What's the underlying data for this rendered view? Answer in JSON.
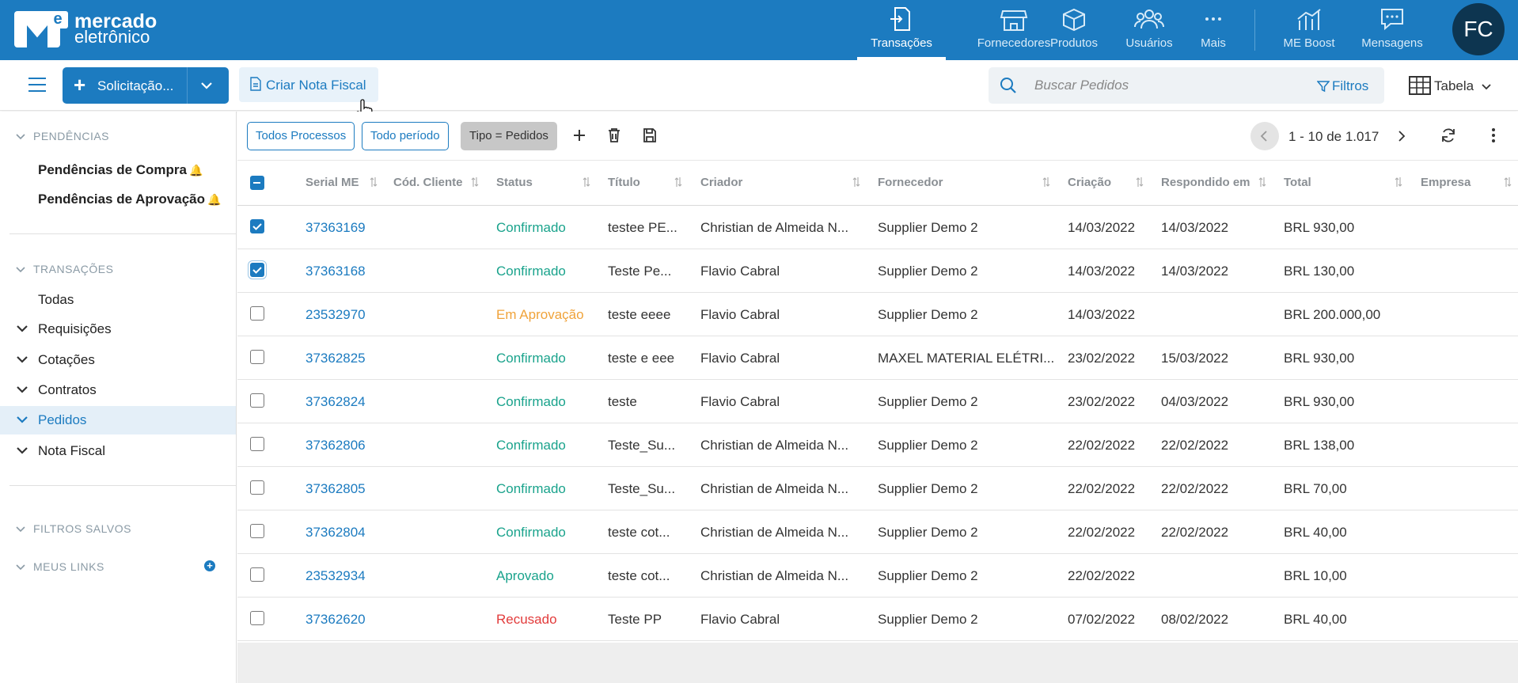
{
  "brand": {
    "line1": "mercado",
    "line2": "eletrônico",
    "mark_letter": "e"
  },
  "colors": {
    "primary": "#1c7bc0",
    "confirmado": "#1aa38c",
    "em_aprovacao": "#f0a33a",
    "recusado": "#e23b3b"
  },
  "topnav": {
    "items": [
      {
        "label": "Transações",
        "icon": "transactions-icon",
        "active": true
      },
      {
        "label": "Fornecedores",
        "icon": "store-icon"
      },
      {
        "label": "Produtos",
        "icon": "box-icon"
      },
      {
        "label": "Usuários",
        "icon": "users-icon"
      },
      {
        "label": "Mais",
        "icon": "more-icon"
      },
      {
        "label": "ME Boost",
        "icon": "chart-icon"
      },
      {
        "label": "Mensagens",
        "icon": "message-icon"
      }
    ],
    "avatar": "FC"
  },
  "toolbar": {
    "solicitacao_label": "Solicitação...",
    "nota_fiscal_label": "Criar Nota Fiscal",
    "search_placeholder": "Buscar Pedidos",
    "filtros_label": "Filtros",
    "view_label": "Tabela"
  },
  "sidebar": {
    "pendencias_header": "PENDÊNCIAS",
    "pendencias": [
      "Pendências de Compra",
      "Pendências de Aprovação"
    ],
    "transacoes_header": "TRANSAÇÕES",
    "todas": "Todas",
    "groups": [
      "Requisições",
      "Cotações",
      "Contratos",
      "Pedidos",
      "Nota Fiscal"
    ],
    "active_group": "Pedidos",
    "filtros_salvos_header": "FILTROS SALVOS",
    "meus_links_header": "MEUS LINKS"
  },
  "filterbar": {
    "chips": [
      "Todos Processos",
      "Todo período",
      "Tipo = Pedidos"
    ],
    "pagination": "1 - 10 de 1.017"
  },
  "table": {
    "columns": [
      "Serial ME",
      "Cód. Cliente",
      "Status",
      "Título",
      "Criador",
      "Fornecedor",
      "Criação",
      "Respondido em",
      "Total",
      "Empresa"
    ],
    "rows": [
      {
        "checked": true,
        "serial": "37363169",
        "cod": "",
        "status": "Confirmado",
        "titulo": "testee PE...",
        "criador": "Christian de Almeida N...",
        "fornecedor": "Supplier Demo 2",
        "criacao": "14/03/2022",
        "respondido": "14/03/2022",
        "total": "BRL 930,00",
        "empresa": ""
      },
      {
        "checked": true,
        "serial": "37363168",
        "cod": "",
        "status": "Confirmado",
        "titulo": "Teste Pe...",
        "criador": "Flavio Cabral",
        "fornecedor": "Supplier Demo 2",
        "criacao": "14/03/2022",
        "respondido": "14/03/2022",
        "total": "BRL 130,00",
        "empresa": ""
      },
      {
        "checked": false,
        "serial": "23532970",
        "cod": "",
        "status": "Em Aprovação",
        "titulo": "teste eeee",
        "criador": "Flavio Cabral",
        "fornecedor": "Supplier Demo 2",
        "criacao": "14/03/2022",
        "respondido": "",
        "total": "BRL 200.000,00",
        "empresa": ""
      },
      {
        "checked": false,
        "serial": "37362825",
        "cod": "",
        "status": "Confirmado",
        "titulo": "teste e eee",
        "criador": "Flavio Cabral",
        "fornecedor": "MAXEL MATERIAL ELÉTRI...",
        "criacao": "23/02/2022",
        "respondido": "15/03/2022",
        "total": "BRL 930,00",
        "empresa": ""
      },
      {
        "checked": false,
        "serial": "37362824",
        "cod": "",
        "status": "Confirmado",
        "titulo": "teste",
        "criador": "Flavio Cabral",
        "fornecedor": "Supplier Demo 2",
        "criacao": "23/02/2022",
        "respondido": "04/03/2022",
        "total": "BRL 930,00",
        "empresa": ""
      },
      {
        "checked": false,
        "serial": "37362806",
        "cod": "",
        "status": "Confirmado",
        "titulo": "Teste_Su...",
        "criador": "Christian de Almeida N...",
        "fornecedor": "Supplier Demo 2",
        "criacao": "22/02/2022",
        "respondido": "22/02/2022",
        "total": "BRL 138,00",
        "empresa": ""
      },
      {
        "checked": false,
        "serial": "37362805",
        "cod": "",
        "status": "Confirmado",
        "titulo": "Teste_Su...",
        "criador": "Christian de Almeida N...",
        "fornecedor": "Supplier Demo 2",
        "criacao": "22/02/2022",
        "respondido": "22/02/2022",
        "total": "BRL 70,00",
        "empresa": ""
      },
      {
        "checked": false,
        "serial": "37362804",
        "cod": "",
        "status": "Confirmado",
        "titulo": "teste cot...",
        "criador": "Christian de Almeida N...",
        "fornecedor": "Supplier Demo 2",
        "criacao": "22/02/2022",
        "respondido": "22/02/2022",
        "total": "BRL 40,00",
        "empresa": ""
      },
      {
        "checked": false,
        "serial": "23532934",
        "cod": "",
        "status": "Aprovado",
        "titulo": "teste cot...",
        "criador": "Christian de Almeida N...",
        "fornecedor": "Supplier Demo 2",
        "criacao": "22/02/2022",
        "respondido": "",
        "total": "BRL 10,00",
        "empresa": ""
      },
      {
        "checked": false,
        "serial": "37362620",
        "cod": "",
        "status": "Recusado",
        "titulo": "Teste PP",
        "criador": "Flavio Cabral",
        "fornecedor": "Supplier Demo 2",
        "criacao": "07/02/2022",
        "respondido": "08/02/2022",
        "total": "BRL 40,00",
        "empresa": ""
      }
    ]
  }
}
